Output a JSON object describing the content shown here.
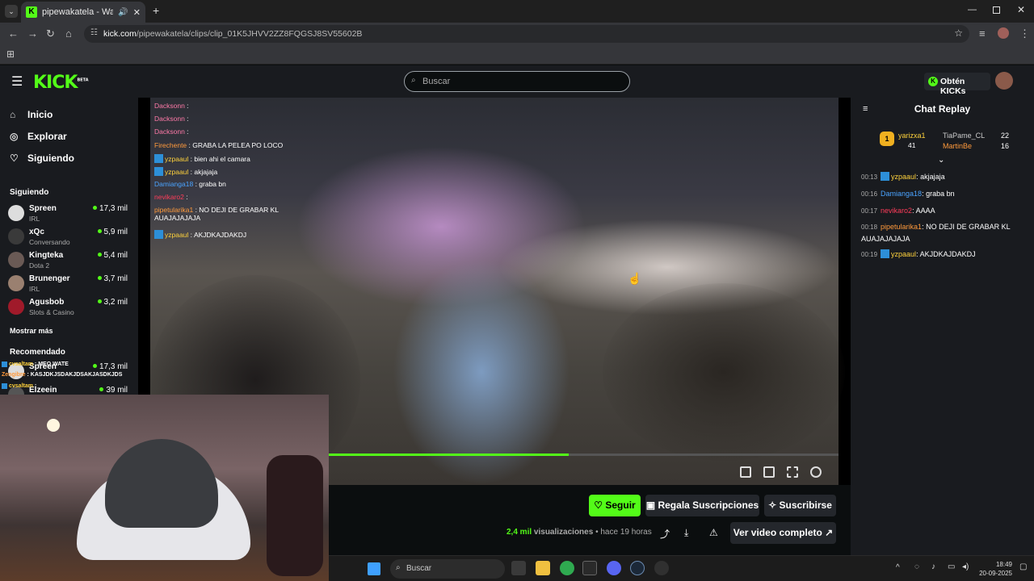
{
  "browser": {
    "tab_title": "pipewakatela - Watch clips",
    "url_host": "kick.com",
    "url_path": "/pipewakatela/clips/clip_01K5JHVV2ZZ8FQGSJ8SV55602B",
    "icons": [
      "back-icon",
      "forward-icon",
      "reload-icon",
      "home-icon",
      "star-icon",
      "menu-icon"
    ]
  },
  "header": {
    "search_placeholder": "Buscar",
    "kicks_label": "Obtén KICKs",
    "logo_text": "KICK",
    "logo_sup": "BETA"
  },
  "sidebar": {
    "nav": [
      {
        "label": "Inicio",
        "icon": "home-icon"
      },
      {
        "label": "Explorar",
        "icon": "compass-icon"
      },
      {
        "label": "Siguiendo",
        "icon": "heart-icon"
      }
    ],
    "following_heading": "Siguiendo",
    "following": [
      {
        "name": "Spreen",
        "category": "IRL",
        "viewers": "17,3 mil"
      },
      {
        "name": "xQc",
        "category": "Conversando",
        "viewers": "5,9 mil"
      },
      {
        "name": "Kingteka",
        "category": "Dota 2",
        "viewers": "5,4 mil"
      },
      {
        "name": "Brunenger",
        "category": "IRL",
        "viewers": "3,7 mil"
      },
      {
        "name": "Agusbob",
        "category": "Slots & Casino",
        "viewers": "3,2 mil"
      }
    ],
    "show_more": "Mostrar más",
    "recommended_heading": "Recomendado",
    "recommended": [
      {
        "name": "Spreen",
        "viewers": "17,3 mil"
      },
      {
        "name": "Elzeein",
        "viewers": "39 mil"
      }
    ]
  },
  "video_overlay_chat": [
    {
      "user": "Dacksonn",
      "color": "#ff7aa8",
      "text": ""
    },
    {
      "user": "Dacksonn",
      "color": "#ff7aa8",
      "text": ""
    },
    {
      "user": "Dacksonn",
      "color": "#ff7aa8",
      "text": ""
    },
    {
      "user": "Firechente",
      "color": "#ff9a3c",
      "text": "GRABA LA PELEA PO LOCO"
    },
    {
      "user": "yzpaaul",
      "color": "#ffd23c",
      "text": "bien ahi el camara"
    },
    {
      "user": "yzpaaul",
      "color": "#ffd23c",
      "text": "akjajaja"
    },
    {
      "user": "Damianga18",
      "color": "#4aa3ff",
      "text": "graba bn"
    },
    {
      "user": "nevikaro2",
      "color": "#ff3c5a",
      "text": ""
    },
    {
      "user": "pipetularika1",
      "color": "#ff9a3c",
      "text": "NO DEJI DE GRABAR KL AUAJAJAJAJA"
    },
    {
      "user": "yzpaaul",
      "color": "#ffd23c",
      "text": "AKJDKAJDAKDJ"
    }
  ],
  "webcam_chat": [
    {
      "user": "cvsaltam",
      "text": "MEO WATE"
    },
    {
      "user": "Zengibre",
      "text": "KASJDKJSDAKJDSAKJASDKJDS"
    },
    {
      "user": "cvsaltam",
      "text": ""
    }
  ],
  "player": {
    "progress": 0.47,
    "controls": [
      "pip-icon",
      "theater-icon",
      "fullscreen-icon",
      "speed-icon"
    ]
  },
  "actions": {
    "follow": "Seguir",
    "gift": "Regala Suscripciones",
    "subscribe": "Suscribirse",
    "views_count": "2,4 mil",
    "views_label": "visualizaciones",
    "time_ago": "• hace 19 horas",
    "full_video": "Ver video completo"
  },
  "chat_replay": {
    "title": "Chat Replay",
    "leaderboard": {
      "first": {
        "rank": "1",
        "name": "yarizxa1",
        "count": "41"
      },
      "second": {
        "name": "TiaPame_CL",
        "count": "22"
      },
      "third": {
        "name": "MartinBe",
        "count": "16"
      }
    },
    "messages": [
      {
        "time": "00:13",
        "user": "yzpaaul",
        "color": "#ffd23c",
        "text": ": akjajaja"
      },
      {
        "time": "00:16",
        "user": "Damianga18",
        "color": "#4aa3ff",
        "text": ": graba bn"
      },
      {
        "time": "00:17",
        "user": "nevikaro2",
        "color": "#ff3c5a",
        "text": ": AAAA"
      },
      {
        "time": "00:18",
        "user": "pipetularika1",
        "color": "#ff9a3c",
        "text": ": NO DEJI DE GRABAR KL AUAJAJAJAJA"
      },
      {
        "time": "00:19",
        "user": "yzpaaul",
        "color": "#ffd23c",
        "text": ": AKJDKAJDAKDJ"
      }
    ]
  },
  "taskbar": {
    "search": "Buscar",
    "time": "18:49",
    "date": "20-09-2025"
  },
  "colors": {
    "accent": "#53fc18",
    "bg": "#0b0e0f",
    "panel": "#191b1f"
  }
}
